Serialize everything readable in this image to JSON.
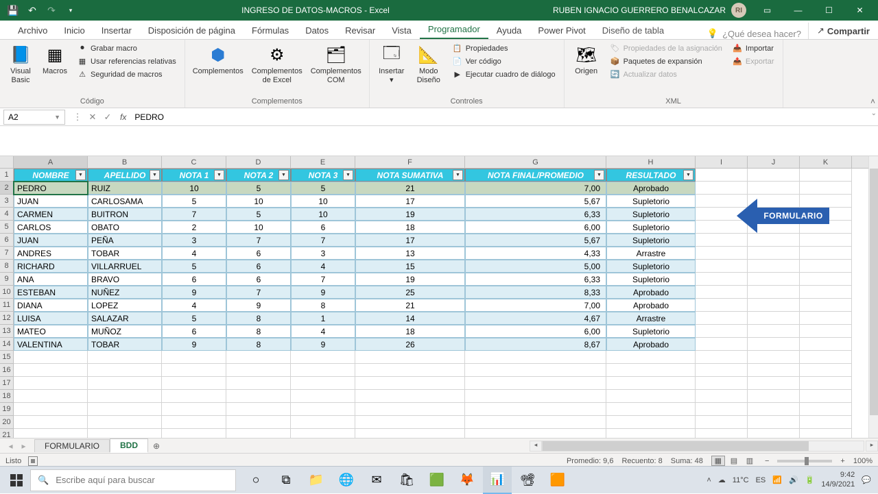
{
  "titlebar": {
    "doc_title": "INGRESO DE DATOS-MACROS  -  Excel",
    "user_name": "RUBEN IGNACIO GUERRERO BENALCAZAR",
    "avatar_initials": "RI"
  },
  "ribbon_tabs": {
    "archivo": "Archivo",
    "inicio": "Inicio",
    "insertar": "Insertar",
    "disposicion": "Disposición de página",
    "formulas": "Fórmulas",
    "datos": "Datos",
    "revisar": "Revisar",
    "vista": "Vista",
    "programador": "Programador",
    "ayuda": "Ayuda",
    "powerpivot": "Power Pivot",
    "diseno_tabla": "Diseño de tabla",
    "tell_me": "¿Qué desea hacer?",
    "compartir": "Compartir"
  },
  "ribbon": {
    "codigo": {
      "visual_basic": "Visual Basic",
      "macros": "Macros",
      "grabar": "Grabar macro",
      "referencias": "Usar referencias relativas",
      "seguridad": "Seguridad de macros",
      "label": "Código"
    },
    "complementos": {
      "complementos": "Complementos",
      "excel": "Complementos de Excel",
      "com": "Complementos COM",
      "label": "Complementos"
    },
    "controles": {
      "insertar": "Insertar",
      "modo": "Modo Diseño",
      "propiedades": "Propiedades",
      "ver_codigo": "Ver código",
      "ejecutar": "Ejecutar cuadro de diálogo",
      "label": "Controles"
    },
    "xml": {
      "origen": "Origen",
      "prop_asignacion": "Propiedades de la asignación",
      "paquetes": "Paquetes de expansión",
      "actualizar": "Actualizar datos",
      "importar": "Importar",
      "exportar": "Exportar",
      "label": "XML"
    }
  },
  "name_box": "A2",
  "formula_value": "PEDRO",
  "columns": [
    "A",
    "B",
    "C",
    "D",
    "E",
    "F",
    "G",
    "H",
    "I",
    "J",
    "K"
  ],
  "headers": {
    "nombre": "NOMBRE",
    "apellido": "APELLIDO",
    "nota1": "NOTA 1",
    "nota2": "NOTA  2",
    "nota3": "NOTA 3",
    "sumativa": "NOTA SUMATIVA",
    "final": "NOTA FINAL/PROMEDIO",
    "resultado": "RESULTADO"
  },
  "rows": [
    {
      "n": "PEDRO",
      "a": "RUIZ",
      "n1": "10",
      "n2": "5",
      "n3": "5",
      "s": "21",
      "f": "7,00",
      "r": "Aprobado"
    },
    {
      "n": "JUAN",
      "a": "CARLOSAMA",
      "n1": "5",
      "n2": "10",
      "n3": "10",
      "s": "17",
      "f": "5,67",
      "r": "Supletorio"
    },
    {
      "n": "CARMEN",
      "a": "BUITRON",
      "n1": "7",
      "n2": "5",
      "n3": "10",
      "s": "19",
      "f": "6,33",
      "r": "Supletorio"
    },
    {
      "n": "CARLOS",
      "a": "OBATO",
      "n1": "2",
      "n2": "10",
      "n3": "6",
      "s": "18",
      "f": "6,00",
      "r": "Supletorio"
    },
    {
      "n": "JUAN",
      "a": "PEÑA",
      "n1": "3",
      "n2": "7",
      "n3": "7",
      "s": "17",
      "f": "5,67",
      "r": "Supletorio"
    },
    {
      "n": "ANDRES",
      "a": "TOBAR",
      "n1": "4",
      "n2": "6",
      "n3": "3",
      "s": "13",
      "f": "4,33",
      "r": "Arrastre"
    },
    {
      "n": "RICHARD",
      "a": "VILLARRUEL",
      "n1": "5",
      "n2": "6",
      "n3": "4",
      "s": "15",
      "f": "5,00",
      "r": "Supletorio"
    },
    {
      "n": "ANA",
      "a": "BRAVO",
      "n1": "6",
      "n2": "6",
      "n3": "7",
      "s": "19",
      "f": "6,33",
      "r": "Supletorio"
    },
    {
      "n": "ESTEBAN",
      "a": "NUÑEZ",
      "n1": "9",
      "n2": "7",
      "n3": "9",
      "s": "25",
      "f": "8,33",
      "r": "Aprobado"
    },
    {
      "n": "DIANA",
      "a": "LOPEZ",
      "n1": "4",
      "n2": "9",
      "n3": "8",
      "s": "21",
      "f": "7,00",
      "r": "Aprobado"
    },
    {
      "n": "LUISA",
      "a": "SALAZAR",
      "n1": "5",
      "n2": "8",
      "n3": "1",
      "s": "14",
      "f": "4,67",
      "r": "Arrastre"
    },
    {
      "n": "MATEO",
      "a": "MUÑOZ",
      "n1": "6",
      "n2": "8",
      "n3": "4",
      "s": "18",
      "f": "6,00",
      "r": "Supletorio"
    },
    {
      "n": "VALENTINA",
      "a": "TOBAR",
      "n1": "9",
      "n2": "8",
      "n3": "9",
      "s": "26",
      "f": "8,67",
      "r": "Aprobado"
    }
  ],
  "formulario_btn": "FORMULARIO",
  "sheets": {
    "s1": "FORMULARIO",
    "s2": "BDD"
  },
  "status": {
    "listo": "Listo",
    "promedio": "Promedio: 9,6",
    "recuento": "Recuento: 8",
    "suma": "Suma: 48",
    "zoom": "100%"
  },
  "taskbar": {
    "search_placeholder": "Escribe aquí para buscar",
    "lang": "ES",
    "weather": "11°C",
    "time": "9:42",
    "date": "14/9/2021"
  }
}
